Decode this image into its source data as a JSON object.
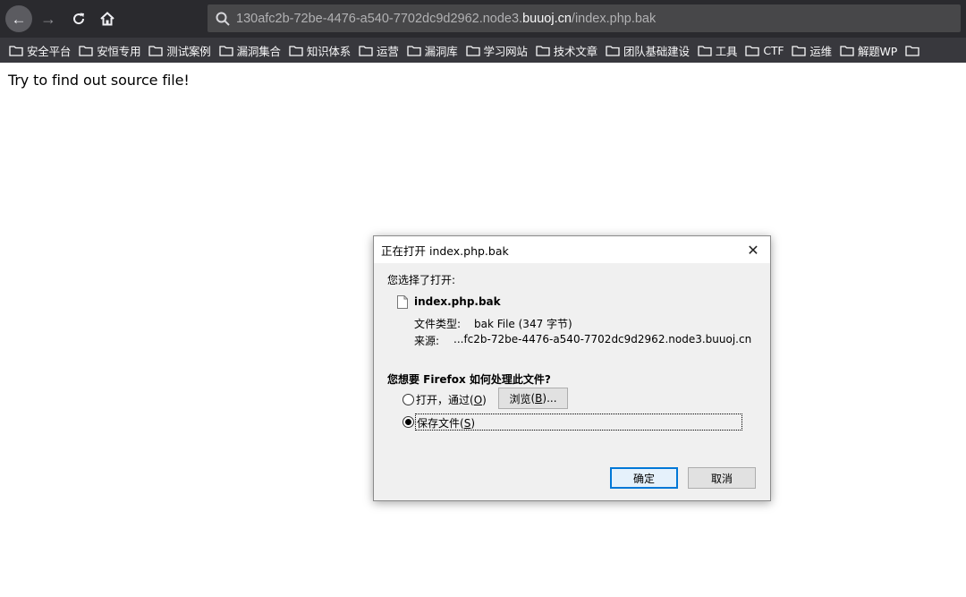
{
  "browser": {
    "url_prefix": "130afc2b-72be-4476-a540-7702dc9d2962.node3.",
    "url_domain": "buuoj.cn",
    "url_suffix": "/index.php.bak"
  },
  "bookmarks": [
    {
      "label": "安全平台"
    },
    {
      "label": "安恒专用"
    },
    {
      "label": "测试案例"
    },
    {
      "label": "漏洞集合"
    },
    {
      "label": "知识体系"
    },
    {
      "label": "运营"
    },
    {
      "label": "漏洞库"
    },
    {
      "label": "学习网站"
    },
    {
      "label": "技术文章"
    },
    {
      "label": "团队基础建设"
    },
    {
      "label": "工具"
    },
    {
      "label": "CTF"
    },
    {
      "label": "运维"
    },
    {
      "label": "解题WP"
    }
  ],
  "page": {
    "text": "Try to find out source file!"
  },
  "dialog": {
    "title": "正在打开 index.php.bak",
    "prompt": "您选择了打开:",
    "filename": "index.php.bak",
    "type_label": "文件类型:",
    "type_value": "bak File (347 字节)",
    "source_label": "来源:",
    "source_value": "...fc2b-72be-4476-a540-7702dc9d2962.node3.buuoj.cn",
    "question": "您想要 Firefox 如何处理此文件?",
    "open_with_text": "打开，通过",
    "open_with_key": "O",
    "browse_text": "浏览",
    "browse_key": "B",
    "browse_suffix": "...",
    "save_text": "保存文件",
    "save_key": "S",
    "selected_option": "save",
    "ok_label": "确定",
    "cancel_label": "取消"
  },
  "colors": {
    "toolbar_bg": "#2a2a2e",
    "bookmarks_bg": "#38383d",
    "urlbar_bg": "#474749",
    "dialog_bg": "#f0f0f0",
    "ok_button_border": "#0078d7"
  }
}
